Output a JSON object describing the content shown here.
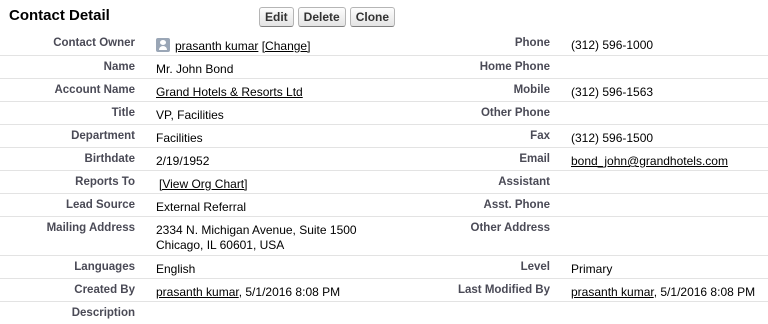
{
  "header": {
    "title": "Contact Detail",
    "buttons": {
      "edit": "Edit",
      "delete": "Delete",
      "clone": "Clone"
    }
  },
  "left": {
    "contact_owner": {
      "label": "Contact Owner",
      "value": "prasanth kumar",
      "action": "[Change]"
    },
    "name": {
      "label": "Name",
      "value": "Mr. John Bond"
    },
    "account_name": {
      "label": "Account Name",
      "value": "Grand Hotels & Resorts Ltd"
    },
    "title": {
      "label": "Title",
      "value": "VP, Facilities"
    },
    "department": {
      "label": "Department",
      "value": "Facilities"
    },
    "birthdate": {
      "label": "Birthdate",
      "value": "2/19/1952"
    },
    "reports_to": {
      "label": "Reports To",
      "value": "[View Org Chart]"
    },
    "lead_source": {
      "label": "Lead Source",
      "value": "External Referral"
    },
    "mailing_address": {
      "label": "Mailing Address",
      "line1": "2334 N. Michigan Avenue, Suite 1500",
      "line2": "Chicago, IL 60601, USA"
    },
    "languages": {
      "label": "Languages",
      "value": "English"
    },
    "created_by": {
      "label": "Created By",
      "user": "prasanth kumar",
      "date": ", 5/1/2016 8:08 PM"
    },
    "description": {
      "label": "Description",
      "value": ""
    }
  },
  "right": {
    "phone": {
      "label": "Phone",
      "value": "(312) 596-1000"
    },
    "home_phone": {
      "label": "Home Phone",
      "value": ""
    },
    "mobile": {
      "label": "Mobile",
      "value": "(312) 596-1563"
    },
    "other_phone": {
      "label": "Other Phone",
      "value": ""
    },
    "fax": {
      "label": "Fax",
      "value": "(312) 596-1500"
    },
    "email": {
      "label": "Email",
      "value": "bond_john@grandhotels.com"
    },
    "assistant": {
      "label": "Assistant",
      "value": ""
    },
    "asst_phone": {
      "label": "Asst. Phone",
      "value": ""
    },
    "other_address": {
      "label": "Other Address",
      "value": ""
    },
    "level": {
      "label": "Level",
      "value": "Primary"
    },
    "last_modified_by": {
      "label": "Last Modified By",
      "user": "prasanth kumar",
      "date": ", 5/1/2016 8:08 PM"
    }
  },
  "icons": {
    "owner": "user-avatar-icon"
  }
}
